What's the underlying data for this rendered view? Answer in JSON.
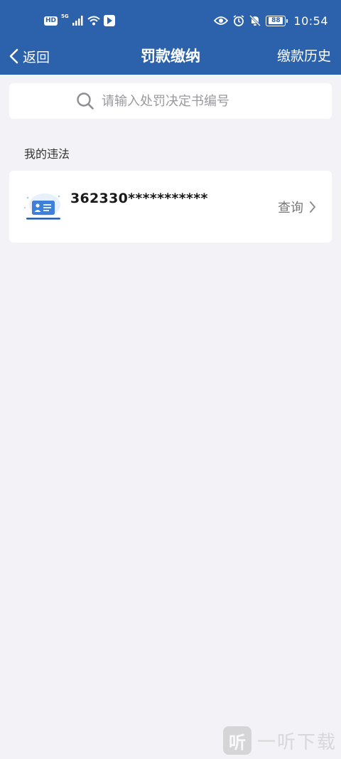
{
  "colors": {
    "primary": "#2c61ab",
    "background": "#f2f2f7",
    "card": "#ffffff"
  },
  "status_bar": {
    "left_badge": "HD",
    "network": "5G",
    "battery": "88",
    "time": "10:54",
    "icons": [
      "signal-icon",
      "wifi-icon",
      "app-notification-icon",
      "eye-icon",
      "alarm-icon",
      "mute-icon",
      "battery-icon"
    ]
  },
  "nav": {
    "back_label": "返回",
    "title": "罚款缴纳",
    "history_label": "缴款历史"
  },
  "search": {
    "placeholder": "请输入处罚决定书编号",
    "value": ""
  },
  "section": {
    "title": "我的违法"
  },
  "violation_card": {
    "id_number": "362330***********",
    "action_label": "查询",
    "icon": "id-card-icon"
  },
  "watermark": {
    "logo_char": "听",
    "text": "一听下载"
  }
}
